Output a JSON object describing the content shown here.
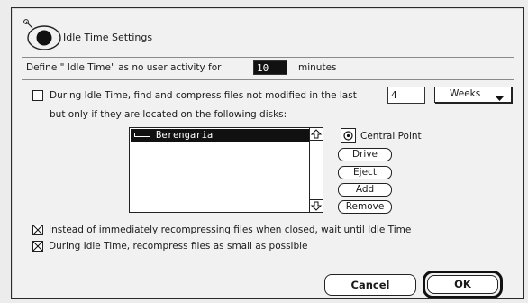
{
  "dialog": {
    "title": "Idle Time Settings",
    "icon": "clock-icon"
  },
  "idle_define": {
    "label_before": "Define \" Idle Time\" as no user activity for",
    "minutes_value": "10",
    "label_after": "minutes"
  },
  "compress_option": {
    "checked": false,
    "label": "During Idle Time, find and compress files not modified in the last",
    "age_value": "4",
    "unit_selected": "Weeks",
    "disk_label": "but only if they are located on the following disks:"
  },
  "disk_list": {
    "items": [
      "Berengaria"
    ]
  },
  "disk_panel": {
    "drive_name": "Central Point",
    "drive_icon": "disk-drive-icon",
    "buttons": {
      "drive": "Drive",
      "eject": "Eject",
      "add": "Add",
      "remove": "Remove"
    }
  },
  "options": {
    "recompress_on_idle": {
      "checked": true,
      "label": "Instead of immediately recompressing files when closed, wait until Idle Time"
    },
    "recompress_small": {
      "checked": true,
      "label": "During Idle Time, recompress files as small as possible"
    }
  },
  "footer": {
    "cancel_label": "Cancel",
    "ok_label": "OK"
  }
}
